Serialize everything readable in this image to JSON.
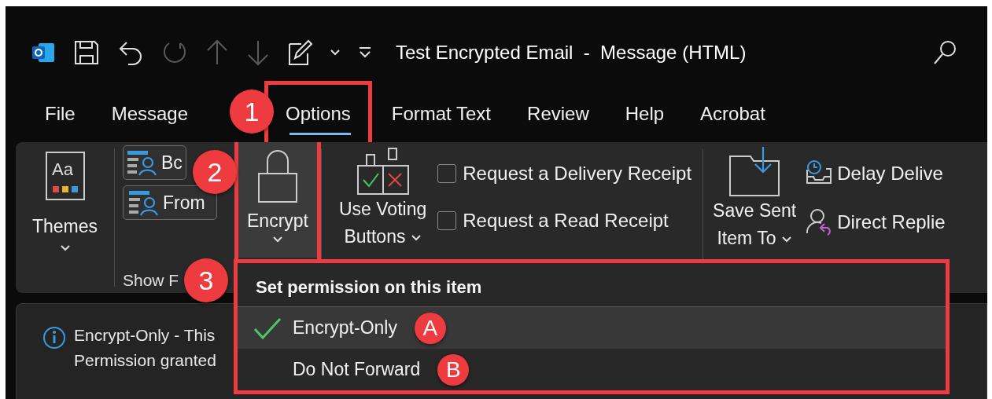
{
  "window": {
    "title": "Test Encrypted Email  -  Message (HTML)"
  },
  "quick_access": [
    {
      "kind": "app-logo"
    },
    {
      "kind": "save",
      "disabled": false
    },
    {
      "kind": "undo",
      "disabled": false
    },
    {
      "kind": "redo",
      "disabled": true
    },
    {
      "kind": "up",
      "disabled": true
    },
    {
      "kind": "down",
      "disabled": true
    },
    {
      "kind": "compose",
      "disabled": false
    },
    {
      "kind": "chevron",
      "disabled": false
    },
    {
      "kind": "customize",
      "disabled": false
    }
  ],
  "tabs": [
    {
      "label": "File",
      "selected": false,
      "highlighted": false
    },
    {
      "label": "Message",
      "selected": false,
      "highlighted": false
    },
    {
      "label": "Options",
      "selected": true,
      "highlighted": true,
      "callout": "1"
    },
    {
      "label": "Format Text",
      "selected": false,
      "highlighted": false
    },
    {
      "label": "Review",
      "selected": false,
      "highlighted": false
    },
    {
      "label": "Help",
      "selected": false,
      "highlighted": false
    },
    {
      "label": "Acrobat",
      "selected": false,
      "highlighted": false
    }
  ],
  "ribbon": {
    "themes": {
      "icon_text": "Aa",
      "label": "Themes"
    },
    "show_fields": {
      "buttons": [
        {
          "label": "Bc"
        },
        {
          "label": "From"
        }
      ],
      "group_label": "Show F"
    },
    "encrypt": {
      "label": "Encrypt",
      "highlighted": true,
      "callout": "2"
    },
    "voting": {
      "lines": [
        "Use Voting",
        "Buttons"
      ]
    },
    "checkboxes": [
      {
        "label": "Request a Delivery Receipt",
        "checked": false
      },
      {
        "label": "Request a Read Receipt",
        "checked": false
      }
    ],
    "save_sent": {
      "lines": [
        "Save Sent",
        "Item To"
      ]
    },
    "more": [
      {
        "kind": "delay",
        "label": "Delay Delive"
      },
      {
        "kind": "replies",
        "label": "Direct Replie"
      }
    ]
  },
  "message_info": {
    "lines": [
      "Encrypt-Only - This",
      "Permission granted"
    ]
  },
  "dropdown": {
    "callout": "3",
    "header": "Set permission on this item",
    "items": [
      {
        "label": "Encrypt-Only",
        "checked": true,
        "hovered": true,
        "callout": "A"
      },
      {
        "label": "Do Not Forward",
        "checked": false,
        "hovered": false,
        "callout": "B"
      }
    ]
  }
}
